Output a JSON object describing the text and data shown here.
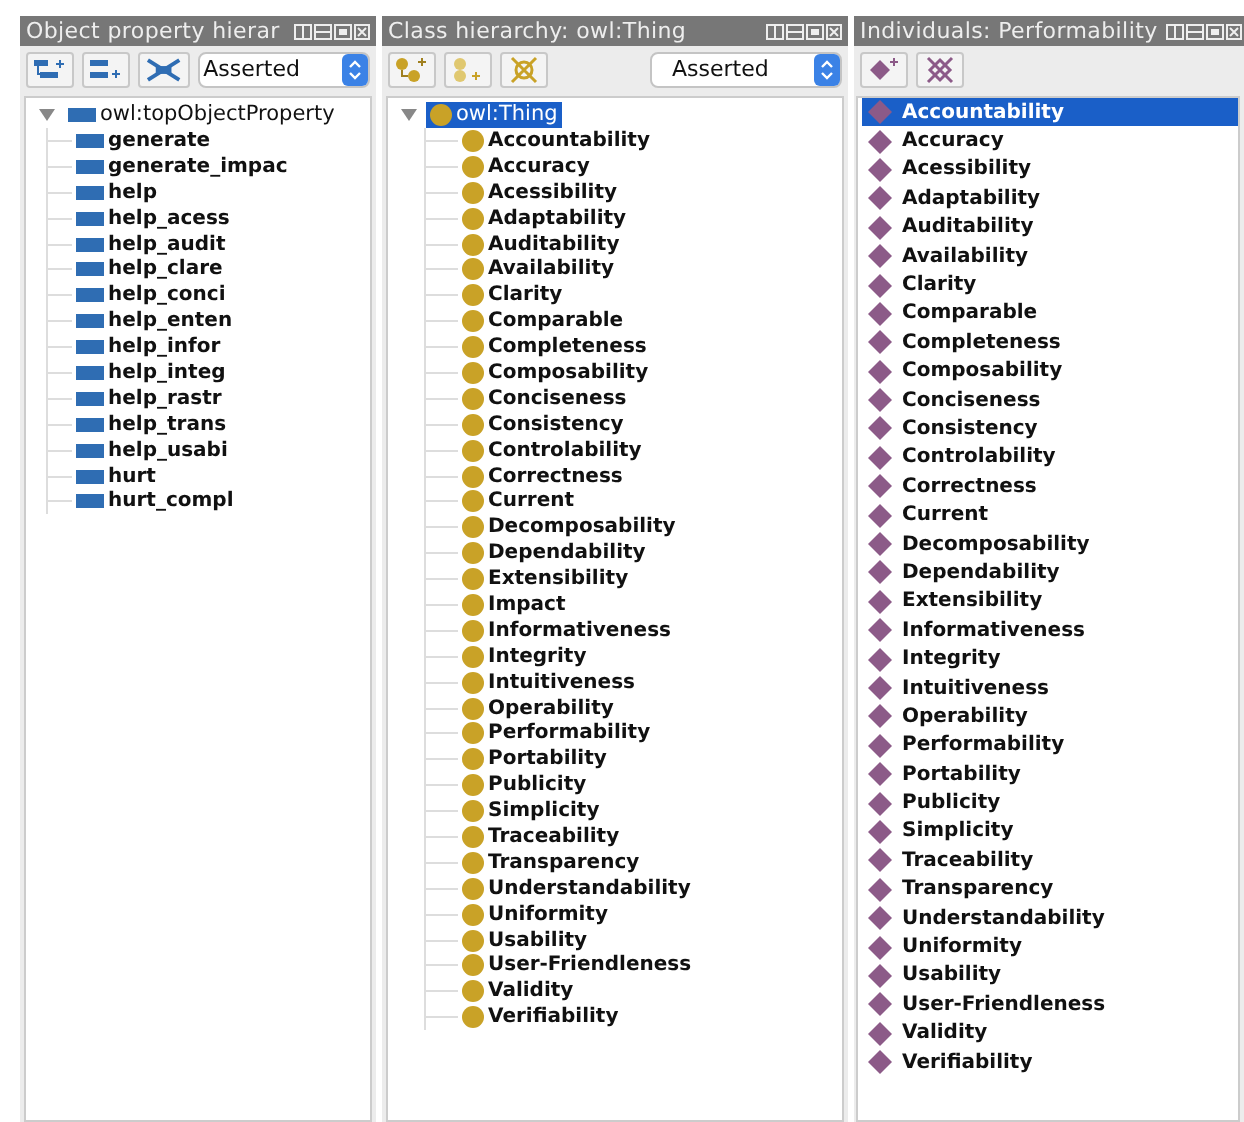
{
  "panels": [
    {
      "kind": "property",
      "title": "Object property hierar",
      "mode": "Asserted",
      "tree": {
        "label": "owl:topObjectProperty",
        "expanded": true,
        "selected": false,
        "children": [
          {
            "label": "generate",
            "selected": false
          },
          {
            "label": "generate_impac",
            "selected": false
          },
          {
            "label": "help",
            "selected": false
          },
          {
            "label": "help_acess",
            "selected": false
          },
          {
            "label": "help_audit",
            "selected": false
          },
          {
            "label": "help_clare",
            "selected": false
          },
          {
            "label": "help_conci",
            "selected": false
          },
          {
            "label": "help_enten",
            "selected": false
          },
          {
            "label": "help_infor",
            "selected": false
          },
          {
            "label": "help_integ",
            "selected": false
          },
          {
            "label": "help_rastr",
            "selected": false
          },
          {
            "label": "help_trans",
            "selected": false
          },
          {
            "label": "help_usabi",
            "selected": false
          },
          {
            "label": "hurt",
            "selected": false
          },
          {
            "label": "hurt_compl",
            "selected": false
          }
        ]
      }
    },
    {
      "kind": "class",
      "title": "Class hierarchy: owl:Thing",
      "mode": "Asserted",
      "tree": {
        "label": "owl:Thing",
        "expanded": true,
        "selected": true,
        "children": [
          {
            "label": "Accountability",
            "selected": false
          },
          {
            "label": "Accuracy",
            "selected": false
          },
          {
            "label": "Acessibility",
            "selected": false
          },
          {
            "label": "Adaptability",
            "selected": false
          },
          {
            "label": "Auditability",
            "selected": false
          },
          {
            "label": "Availability",
            "selected": false
          },
          {
            "label": "Clarity",
            "selected": false
          },
          {
            "label": "Comparable",
            "selected": false
          },
          {
            "label": "Completeness",
            "selected": false
          },
          {
            "label": "Composability",
            "selected": false
          },
          {
            "label": "Conciseness",
            "selected": false
          },
          {
            "label": "Consistency",
            "selected": false
          },
          {
            "label": "Controlability",
            "selected": false
          },
          {
            "label": "Correctness",
            "selected": false
          },
          {
            "label": "Current",
            "selected": false
          },
          {
            "label": "Decomposability",
            "selected": false
          },
          {
            "label": "Dependability",
            "selected": false
          },
          {
            "label": "Extensibility",
            "selected": false
          },
          {
            "label": "Impact",
            "selected": false
          },
          {
            "label": "Informativeness",
            "selected": false
          },
          {
            "label": "Integrity",
            "selected": false
          },
          {
            "label": "Intuitiveness",
            "selected": false
          },
          {
            "label": "Operability",
            "selected": false
          },
          {
            "label": "Performability",
            "selected": false
          },
          {
            "label": "Portability",
            "selected": false
          },
          {
            "label": "Publicity",
            "selected": false
          },
          {
            "label": "Simplicity",
            "selected": false
          },
          {
            "label": "Traceability",
            "selected": false
          },
          {
            "label": "Transparency",
            "selected": false
          },
          {
            "label": "Understandability",
            "selected": false
          },
          {
            "label": "Uniformity",
            "selected": false
          },
          {
            "label": "Usability",
            "selected": false
          },
          {
            "label": "User-Friendleness",
            "selected": false
          },
          {
            "label": "Validity",
            "selected": false
          },
          {
            "label": "Verifiability",
            "selected": false
          }
        ]
      }
    },
    {
      "kind": "individual",
      "title": "Individuals: Performability",
      "items": [
        {
          "label": "Accountability",
          "selected": true
        },
        {
          "label": "Accuracy",
          "selected": false
        },
        {
          "label": "Acessibility",
          "selected": false
        },
        {
          "label": "Adaptability",
          "selected": false
        },
        {
          "label": "Auditability",
          "selected": false
        },
        {
          "label": "Availability",
          "selected": false
        },
        {
          "label": "Clarity",
          "selected": false
        },
        {
          "label": "Comparable",
          "selected": false
        },
        {
          "label": "Completeness",
          "selected": false
        },
        {
          "label": "Composability",
          "selected": false
        },
        {
          "label": "Conciseness",
          "selected": false
        },
        {
          "label": "Consistency",
          "selected": false
        },
        {
          "label": "Controlability",
          "selected": false
        },
        {
          "label": "Correctness",
          "selected": false
        },
        {
          "label": "Current",
          "selected": false
        },
        {
          "label": "Decomposability",
          "selected": false
        },
        {
          "label": "Dependability",
          "selected": false
        },
        {
          "label": "Extensibility",
          "selected": false
        },
        {
          "label": "Informativeness",
          "selected": false
        },
        {
          "label": "Integrity",
          "selected": false
        },
        {
          "label": "Intuitiveness",
          "selected": false
        },
        {
          "label": "Operability",
          "selected": false
        },
        {
          "label": "Performability",
          "selected": false
        },
        {
          "label": "Portability",
          "selected": false
        },
        {
          "label": "Publicity",
          "selected": false
        },
        {
          "label": "Simplicity",
          "selected": false
        },
        {
          "label": "Traceability",
          "selected": false
        },
        {
          "label": "Transparency",
          "selected": false
        },
        {
          "label": "Understandability",
          "selected": false
        },
        {
          "label": "Uniformity",
          "selected": false
        },
        {
          "label": "Usability",
          "selected": false
        },
        {
          "label": "User-Friendleness",
          "selected": false
        },
        {
          "label": "Validity",
          "selected": false
        },
        {
          "label": "Verifiability",
          "selected": false
        }
      ]
    }
  ]
}
